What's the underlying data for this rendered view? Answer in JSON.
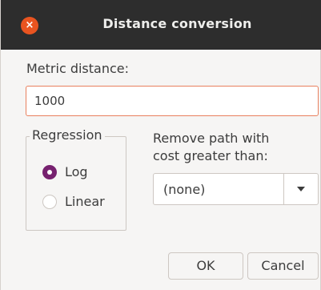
{
  "dialog": {
    "title": "Distance conversion",
    "close_icon": "×"
  },
  "metric": {
    "label": "Metric distance:",
    "value": "1000"
  },
  "regression": {
    "legend": "Regression",
    "options": [
      {
        "label": "Log",
        "selected": true
      },
      {
        "label": "Linear",
        "selected": false
      }
    ]
  },
  "remove_path": {
    "label_line1": "Remove path with",
    "label_line2": "cost greater than:",
    "selected": "(none)"
  },
  "buttons": {
    "ok_label": "OK",
    "cancel_label": "Cancel"
  },
  "colors": {
    "titlebar": "#2d2d2d",
    "close_button": "#e95420",
    "radio_checked": "#77216f",
    "input_focus_border": "#e9805e"
  },
  "icons": {
    "close": "close-icon",
    "dropdown": "chevron-down-icon"
  }
}
